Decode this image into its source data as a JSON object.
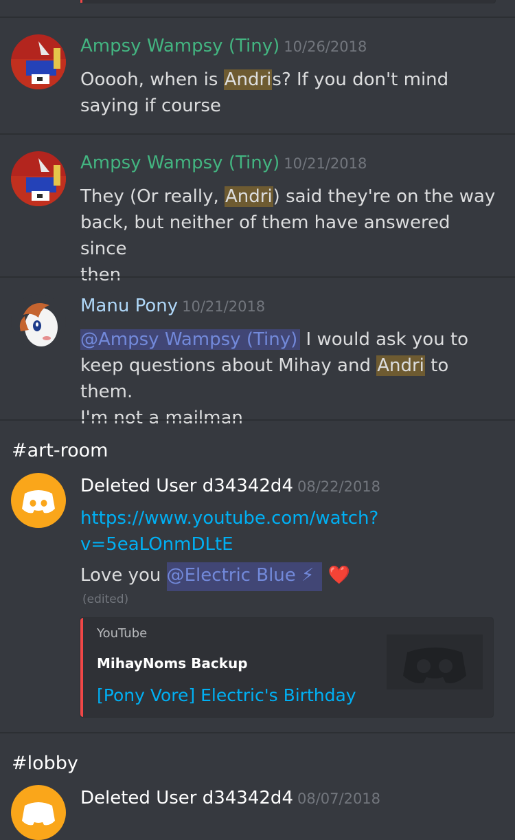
{
  "messages": [
    {
      "author": "Ampsy Wampsy (Tiny)",
      "author_color": "#43b581",
      "timestamp": "10/26/2018",
      "text_before": "Ooooh, when is ",
      "highlight": "Andri",
      "text_after_line1": "s? If you don't mind",
      "text_line2": "saying if course"
    },
    {
      "author": "Ampsy Wampsy (Tiny)",
      "author_color": "#43b581",
      "timestamp": "10/21/2018",
      "text_before": "They (Or really, ",
      "highlight": "Andri",
      "text_after_line1": ") said they're on the way",
      "text_line2": "back, but neither of them have answered since",
      "text_line3": "then"
    },
    {
      "author": "Manu Pony",
      "author_color": "#afd7f8",
      "timestamp": "10/21/2018",
      "mention": "@Ampsy Wampsy (Tiny)",
      "text_after_mention": " I would ask you to",
      "text_line2_before": "keep questions about Mihay and ",
      "highlight": "Andri",
      "text_line2_after": " to them.",
      "text_line3": "I'm not a mailman"
    }
  ],
  "art_room": {
    "channel": "#art-room",
    "author": "Deleted User d34342d4",
    "timestamp": "08/22/2018",
    "link_line1": "https://www.youtube.com/watch?",
    "link_line2": "v=5eaLOnmDLtE",
    "text_before": "Love you ",
    "mention": "@Electric Blue ⚡",
    "heart": "❤️",
    "edited": "(edited)",
    "embed": {
      "provider": "YouTube",
      "author": "MihayNoms Backup",
      "title": "[Pony Vore] Electric's Birthday"
    }
  },
  "lobby": {
    "channel": "#lobby",
    "author": "Deleted User d34342d4",
    "timestamp": "08/07/2018"
  },
  "colors": {
    "background": "#36393f",
    "highlight": "#6e5b31",
    "mention_bg": "#414675",
    "mention_text": "#7289da",
    "link": "#00b0f4",
    "embed_bar": "#f04747",
    "deleted_avatar": "#faa61a"
  }
}
